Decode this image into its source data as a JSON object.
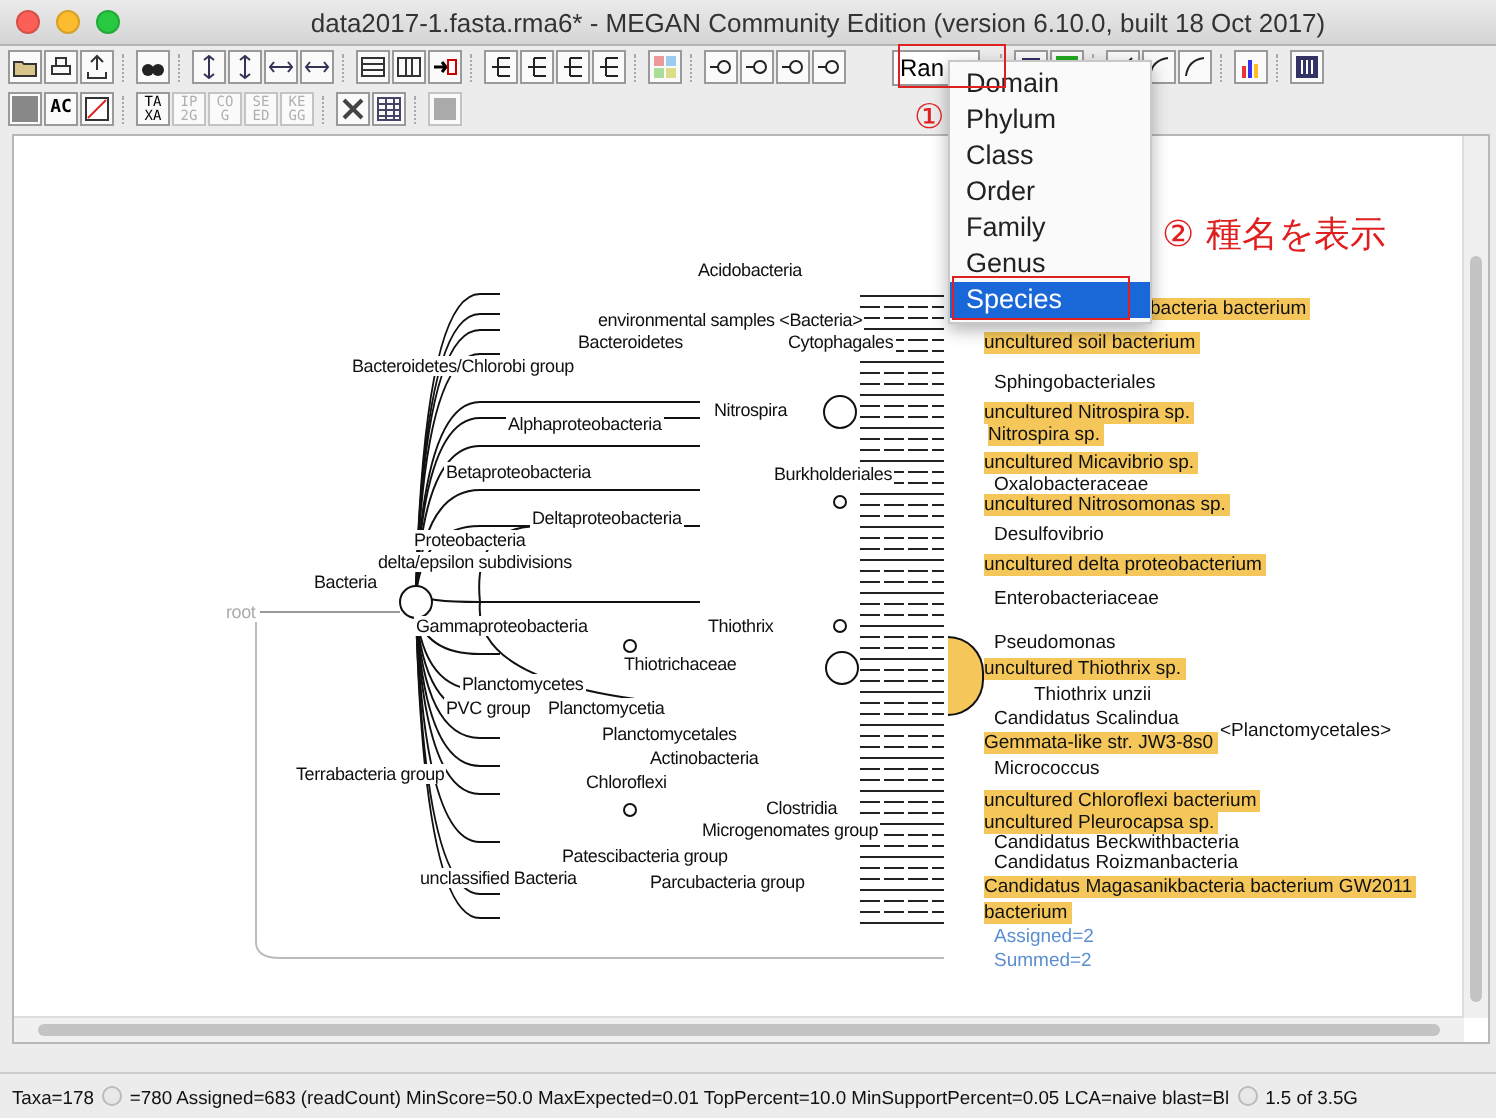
{
  "window": {
    "title": "data2017-1.fasta.rma6* - MEGAN Community Edition (version 6.10.0, built 18 Oct 2017)"
  },
  "toolbar": {
    "rank_selector": {
      "value": "Ran"
    },
    "text_buttons": [
      {
        "lines": [
          "AC"
        ]
      },
      {
        "lines": [
          "TA",
          "XA"
        ],
        "disabled": false
      },
      {
        "lines": [
          "IP",
          "2G"
        ],
        "disabled": true
      },
      {
        "lines": [
          "CO",
          "G"
        ],
        "disabled": true
      },
      {
        "lines": [
          "SE",
          "ED"
        ],
        "disabled": true
      },
      {
        "lines": [
          "KE",
          "GG"
        ],
        "disabled": true
      }
    ]
  },
  "rank_menu": {
    "items": [
      {
        "label": "Domain",
        "selected": false
      },
      {
        "label": "Phylum",
        "selected": false
      },
      {
        "label": "Class",
        "selected": false
      },
      {
        "label": "Order",
        "selected": false
      },
      {
        "label": "Family",
        "selected": false
      },
      {
        "label": "Genus",
        "selected": false
      },
      {
        "label": "Species",
        "selected": true
      }
    ]
  },
  "annotations": [
    {
      "kind": "marker",
      "text": "①"
    },
    {
      "kind": "callout",
      "text": "② 種名を表示"
    }
  ],
  "tree": {
    "root": "root",
    "internal_nodes": [
      "Acidobacteria",
      "environmental samples <Bacteria>",
      "Bacteroidetes",
      "Cytophagales",
      "Bacteroidetes/Chlorobi group",
      "Nitrospira",
      "Alphaproteobacteria",
      "Betaproteobacteria",
      "Burkholderiales",
      "Deltaproteobacteria",
      "Proteobacteria",
      "delta/epsilon subdivisions",
      "Bacteria",
      "Gammaproteobacteria",
      "Thiothrix",
      "Thiotrichaceae",
      "Planctomycetes",
      "PVC group",
      "Planctomycetia",
      "Planctomycetales",
      "Actinobacteria",
      "Terrabacteria group",
      "Chloroflexi",
      "Clostridia",
      "Microgenomates group",
      "Patescibacteria group",
      "unclassified Bacteria",
      "Parcubacteria group"
    ],
    "leaves": [
      {
        "label": "bacteria bacterium",
        "highlighted": true
      },
      {
        "label": "uncultured soil bacterium",
        "highlighted": true
      },
      {
        "label": "Sphingobacteriales",
        "highlighted": false
      },
      {
        "label": "uncultured Nitrospira sp.",
        "highlighted": true
      },
      {
        "label": "Nitrospira sp.",
        "highlighted": true
      },
      {
        "label": "uncultured Micavibrio sp.",
        "highlighted": true
      },
      {
        "label": "Oxalobacteraceae",
        "highlighted": false
      },
      {
        "label": "uncultured Nitrosomonas sp.",
        "highlighted": true
      },
      {
        "label": "Desulfovibrio",
        "highlighted": false
      },
      {
        "label": "uncultured delta proteobacterium",
        "highlighted": true
      },
      {
        "label": "Enterobacteriaceae",
        "highlighted": false
      },
      {
        "label": "Pseudomonas",
        "highlighted": false
      },
      {
        "label": "uncultured Thiothrix sp.",
        "highlighted": true
      },
      {
        "label": "Thiothrix unzii",
        "highlighted": false
      },
      {
        "label": "Candidatus Scalindua",
        "highlighted": false
      },
      {
        "label": "<Planctomycetales>",
        "highlighted": false
      },
      {
        "label": "Gemmata-like str. JW3-8s0",
        "highlighted": true
      },
      {
        "label": "Micrococcus",
        "highlighted": false
      },
      {
        "label": "uncultured Chloroflexi bacterium",
        "highlighted": true
      },
      {
        "label": "uncultured Pleurocapsa sp.",
        "highlighted": true
      },
      {
        "label": "Candidatus Beckwithbacteria",
        "highlighted": false
      },
      {
        "label": "Candidatus Roizmanbacteria",
        "highlighted": false
      },
      {
        "label": "Candidatus Magasanikbacteria bacterium GW2011",
        "highlighted": true
      },
      {
        "label": "bacterium",
        "highlighted": true
      }
    ],
    "counts": [
      "Assigned=2",
      "Summed=2"
    ]
  },
  "status_bar": {
    "taxa": "Taxa=178",
    "details": "=780 Assigned=683 (readCount) MinScore=50.0 MaxExpected=0.01 TopPercent=10.0 MinSupportPercent=0.05 LCA=naive blast=Bl",
    "memory": "1.5 of 3.5G"
  }
}
